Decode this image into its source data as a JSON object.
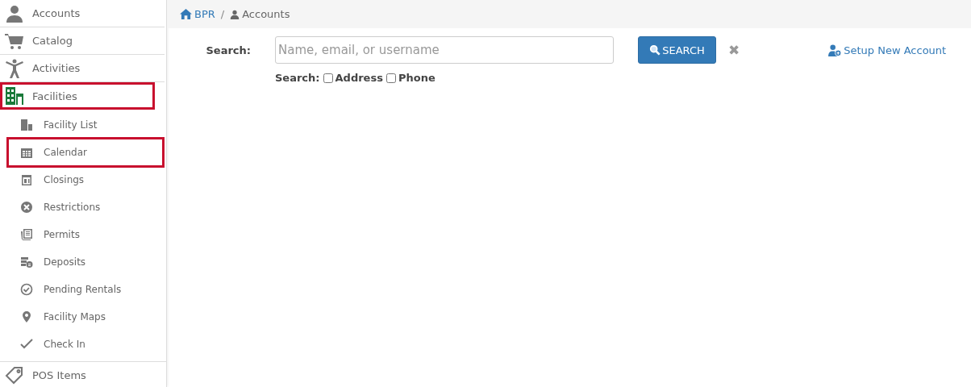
{
  "sidebar": {
    "items": [
      {
        "label": "Accounts",
        "selected": false,
        "highlighted": false
      },
      {
        "label": "Catalog",
        "selected": false,
        "highlighted": false
      },
      {
        "label": "Activities",
        "selected": false,
        "highlighted": false
      },
      {
        "label": "Facilities",
        "selected": true,
        "highlighted": true,
        "children": [
          {
            "label": "Facility List",
            "highlighted": false
          },
          {
            "label": "Calendar",
            "highlighted": true
          },
          {
            "label": "Closings",
            "highlighted": false
          },
          {
            "label": "Restrictions",
            "highlighted": false
          },
          {
            "label": "Permits",
            "highlighted": false
          },
          {
            "label": "Deposits",
            "highlighted": false
          },
          {
            "label": "Pending Rentals",
            "highlighted": false
          },
          {
            "label": "Facility Maps",
            "highlighted": false
          },
          {
            "label": "Check In",
            "highlighted": false
          }
        ]
      },
      {
        "label": "POS Items",
        "selected": false,
        "highlighted": false
      }
    ]
  },
  "breadcrumb": [
    {
      "label": "BPR"
    },
    {
      "label": "Accounts"
    }
  ],
  "breadcrumb_separator": "/",
  "search": {
    "label": "Search:",
    "placeholder": "Name, email, or username",
    "button": "SEARCH",
    "clear": "✖",
    "options_label": "Search:",
    "options": [
      {
        "label": "Address",
        "checked": false
      },
      {
        "label": "Phone",
        "checked": false
      }
    ]
  },
  "setup_link": "Setup New Account"
}
